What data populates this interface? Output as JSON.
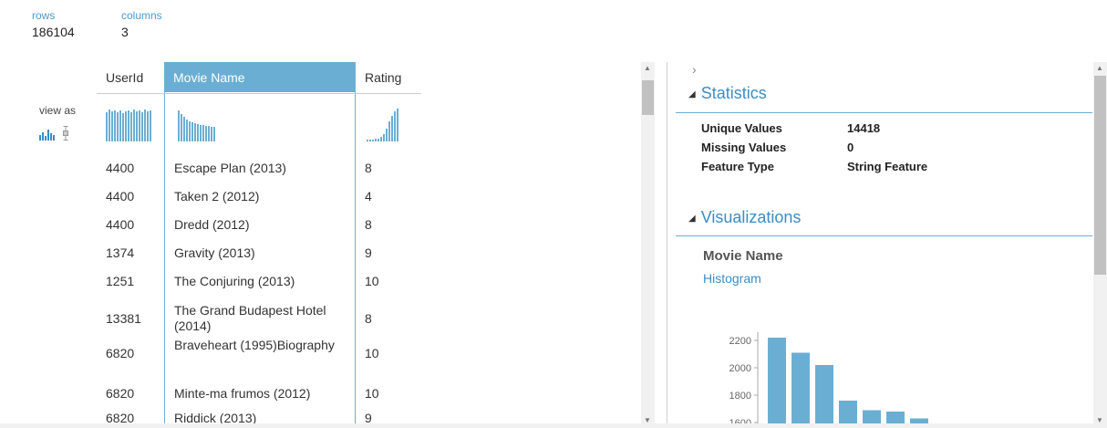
{
  "summary": {
    "rows_label": "rows",
    "rows_value": "186104",
    "columns_label": "columns",
    "columns_value": "3"
  },
  "view_as": {
    "label": "view as",
    "icons": [
      "histogram-icon",
      "boxplot-icon"
    ]
  },
  "table": {
    "columns": [
      "UserId",
      "Movie Name",
      "Rating"
    ],
    "selected_column": "Movie Name",
    "rows": [
      {
        "user": "4400",
        "movie": "Escape Plan (2013)",
        "rating": "8"
      },
      {
        "user": "4400",
        "movie": "Taken 2 (2012)",
        "rating": "4"
      },
      {
        "user": "4400",
        "movie": "Dredd (2012)",
        "rating": "8"
      },
      {
        "user": "1374",
        "movie": "Gravity (2013)",
        "rating": "9"
      },
      {
        "user": "1251",
        "movie": "The Conjuring (2013)",
        "rating": "10"
      },
      {
        "user": "13381",
        "movie": "The Grand Budapest Hotel (2014)",
        "rating": "8"
      },
      {
        "user": "6820",
        "movie": "Braveheart (1995)Biography",
        "rating": "10"
      },
      {
        "user": "6820",
        "movie": "Minte-ma frumos (2012)",
        "rating": "10"
      },
      {
        "user": "6820",
        "movie": "Riddick (2013)",
        "rating": "9"
      }
    ]
  },
  "panel": {
    "statistics_title": "Statistics",
    "stats": [
      {
        "key": "Unique Values",
        "value": "14418"
      },
      {
        "key": "Missing Values",
        "value": "0"
      },
      {
        "key": "Feature Type",
        "value": "String Feature"
      }
    ],
    "visualizations_title": "Visualizations",
    "viz_column": "Movie Name",
    "viz_type": "Histogram"
  },
  "colors": {
    "accent": "#6aafd3",
    "link": "#3c8dc5",
    "bar": "#6aafd3"
  },
  "chart_data": {
    "type": "bar",
    "title": "",
    "xlabel": "",
    "ylabel": "",
    "yticks": [
      2200,
      2000,
      1800,
      1600
    ],
    "ylim": [
      1560,
      2260
    ],
    "values": [
      2220,
      2110,
      2020,
      1760,
      1690,
      1680,
      1630
    ],
    "grid": false
  }
}
